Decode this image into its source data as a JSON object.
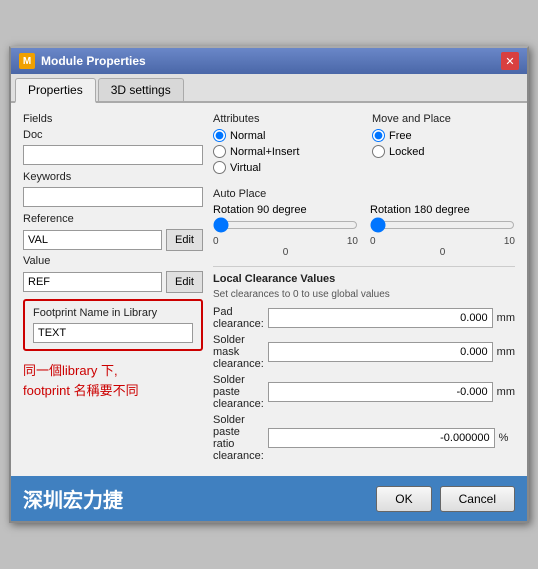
{
  "window": {
    "title": "Module Properties",
    "icon": "M"
  },
  "tabs": [
    {
      "label": "Properties",
      "active": true
    },
    {
      "label": "3D settings",
      "active": false
    }
  ],
  "left": {
    "fields_label": "Fields",
    "doc_label": "Doc",
    "doc_value": "",
    "keywords_label": "Keywords",
    "keywords_value": "",
    "reference_label": "Reference",
    "reference_value": "VAL",
    "edit_label1": "Edit",
    "value_label": "Value",
    "value_value": "REF",
    "edit_label2": "Edit",
    "fp_name_label": "Footprint Name in Library",
    "fp_name_value": "TEXT",
    "note_line1": "同一個library 下,",
    "note_line2": "footprint 名稱要不同"
  },
  "attributes": {
    "title": "Attributes",
    "options": [
      {
        "label": "Normal",
        "checked": true
      },
      {
        "label": "Normal+Insert",
        "checked": false
      },
      {
        "label": "Virtual",
        "checked": false
      }
    ]
  },
  "move_place": {
    "title": "Move and Place",
    "options": [
      {
        "label": "Free",
        "checked": true
      },
      {
        "label": "Locked",
        "checked": false
      }
    ]
  },
  "auto_place": {
    "title": "Auto Place",
    "rotation90": {
      "label": "Rotation 90 degree",
      "min": 0,
      "max": 10,
      "value": 0
    },
    "rotation180": {
      "label": "Rotation 180 degree",
      "min": 0,
      "max": 10,
      "value": 0
    }
  },
  "clearance": {
    "title": "Local Clearance Values",
    "subtitle": "Set clearances to 0 to use global values",
    "rows": [
      {
        "label": "Pad clearance:",
        "value": "0.000",
        "unit": "mm"
      },
      {
        "label": "Solder mask clearance:",
        "value": "0.000",
        "unit": "mm"
      },
      {
        "label": "Solder paste clearance:",
        "value": "-0.000",
        "unit": "mm"
      },
      {
        "label": "Solder paste ratio clearance:",
        "value": "-0.000000",
        "unit": "%"
      }
    ]
  },
  "bottom": {
    "text": "深圳宏力捷",
    "ok_label": "OK",
    "cancel_label": "Cancel"
  }
}
